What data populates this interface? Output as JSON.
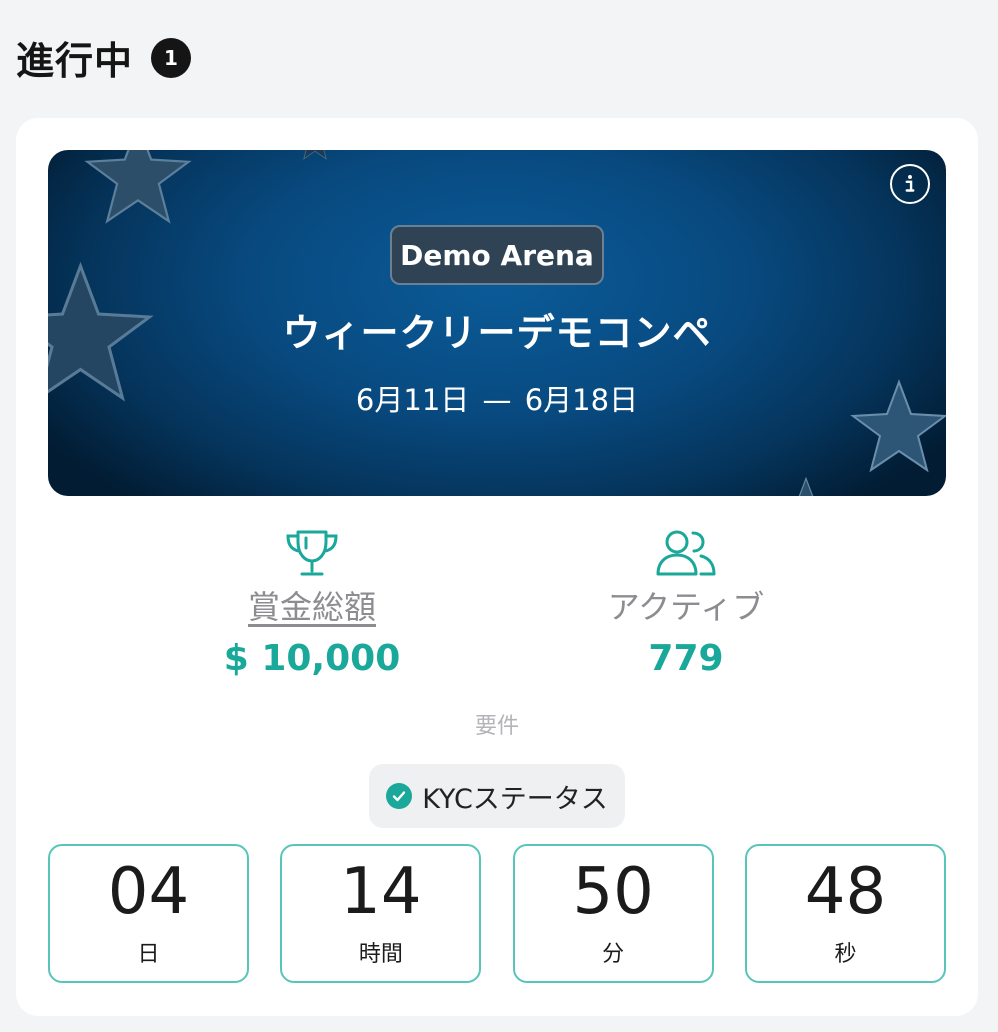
{
  "header": {
    "title": "進行中",
    "count": "1"
  },
  "banner": {
    "badge": "Demo Arena",
    "title": "ウィークリーデモコンペ",
    "dates": "6月11日 — 6月18日",
    "info_icon": "info-icon"
  },
  "stats": {
    "prize": {
      "icon": "trophy-icon",
      "label": "賞金総額",
      "value": "$ 10,000"
    },
    "active": {
      "icon": "users-icon",
      "label": "アクティブ",
      "value": "779"
    }
  },
  "requirements": {
    "label": "要件",
    "kyc": {
      "icon": "check-circle-icon",
      "label": "KYCステータス"
    }
  },
  "countdown": [
    {
      "value": "04",
      "unit": "日"
    },
    {
      "value": "14",
      "unit": "時間"
    },
    {
      "value": "50",
      "unit": "分"
    },
    {
      "value": "48",
      "unit": "秒"
    }
  ],
  "colors": {
    "accent": "#19a899",
    "accent_border": "#59c5ba",
    "banner_blue": "#0b5b98",
    "page_bg": "#f3f4f6"
  }
}
